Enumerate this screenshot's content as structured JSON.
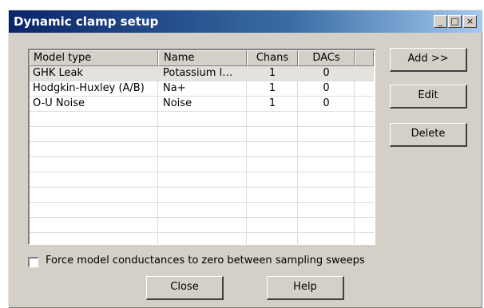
{
  "window": {
    "title": "Dynamic clamp setup",
    "controls": {
      "minimize": "_",
      "maximize": "□",
      "close": "×"
    }
  },
  "table": {
    "headers": [
      "Model type",
      "Name",
      "Chans",
      "DACs"
    ],
    "rows": [
      [
        "GHK Leak",
        "Potassium l…",
        "1",
        "0"
      ],
      [
        "Hodgkin-Huxley (A/B)",
        "Na+",
        "1",
        "0"
      ],
      [
        "O-U Noise",
        "Noise",
        "1",
        "0"
      ]
    ],
    "selected_row": 0
  },
  "buttons": {
    "add": "Add >>",
    "edit": "Edit",
    "delete": "Delete",
    "close": "Close",
    "help": "Help"
  },
  "checkbox": {
    "label": "Force model conductances to zero between sampling sweeps",
    "checked": false
  }
}
